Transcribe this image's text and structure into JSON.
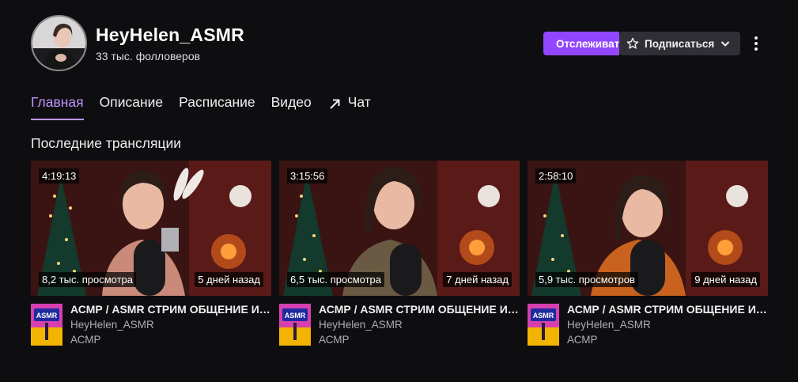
{
  "channel": {
    "name": "HeyHelen_ASMR",
    "followers": "33 тыс. фолловеров"
  },
  "actions": {
    "follow_label": "Отслеживать",
    "subscribe_label": "Подписаться",
    "follow_color": "#9147ff"
  },
  "tabs": [
    {
      "label": "Главная",
      "active": true
    },
    {
      "label": "Описание"
    },
    {
      "label": "Расписание"
    },
    {
      "label": "Видео"
    },
    {
      "label": "Чат",
      "icon": "external-arrow-icon"
    }
  ],
  "section": {
    "title": "Последние трансляции"
  },
  "videos": [
    {
      "duration": "4:19:13",
      "views": "8,2 тыс. просмотра",
      "age": "5 дней назад",
      "title": "АСМР / ASMR СТРИМ ОБЩЕНИЕ И ЗВУКИ",
      "channel": "HeyHelen_ASMR",
      "category": "АСМР"
    },
    {
      "duration": "3:15:56",
      "views": "6,5 тыс. просмотра",
      "age": "7 дней назад",
      "title": "АСМР / ASMR СТРИМ ОБЩЕНИЕ И ЗВУКИ",
      "channel": "HeyHelen_ASMR",
      "category": "АСМР"
    },
    {
      "duration": "2:58:10",
      "views": "5,9 тыс. просмотров",
      "age": "9 дней назад",
      "title": "АСМР / ASMR СТРИМ ОБЩЕНИЕ И ЗВУКИ",
      "channel": "HeyHelen_ASMR",
      "category": "АСМР"
    }
  ],
  "category_art": {
    "label": "ASMR"
  },
  "colors": {
    "accent": "#bf94ff",
    "background": "#0e0e10"
  }
}
